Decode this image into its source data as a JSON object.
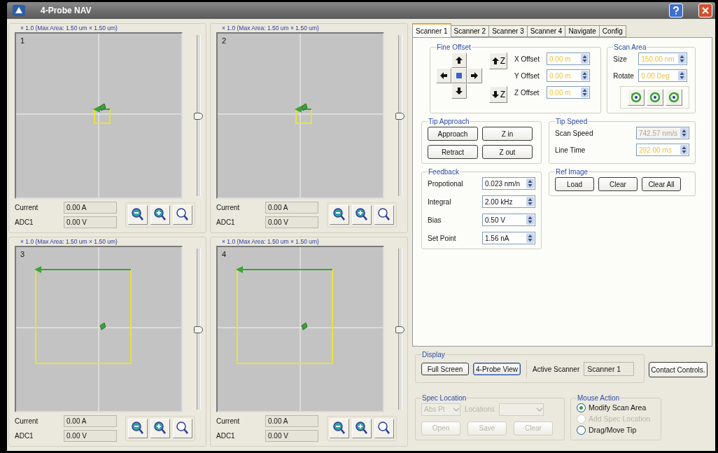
{
  "window": {
    "title": "4-Probe NAV"
  },
  "probes": [
    {
      "header": "× 1.0 (Max Area: 1.50 um × 1.50 um)",
      "number": "1",
      "large_scan": false,
      "slider": {
        "level": 0.5
      },
      "readouts": [
        {
          "label": "Current",
          "value": "0.00 A"
        },
        {
          "label": "ADC1",
          "value": "0.00 V"
        }
      ]
    },
    {
      "header": "× 1.0 (Max Area: 1.50 um × 1.50 um)",
      "number": "2",
      "large_scan": false,
      "slider": {
        "level": 0.5
      },
      "readouts": [
        {
          "label": "Current",
          "value": "0.00 A"
        },
        {
          "label": "ADC1",
          "value": "0.00 V"
        }
      ]
    },
    {
      "header": "× 1.0 (Max Area: 1.50 um × 1.50 um)",
      "number": "3",
      "large_scan": true,
      "slider": {
        "level": 0.5
      },
      "readouts": [
        {
          "label": "Current",
          "value": "0.00 A"
        },
        {
          "label": "ADC1",
          "value": "0.00 V"
        }
      ]
    },
    {
      "header": "× 1.0 (Max Area: 1.50 um × 1.50 um)",
      "number": "4",
      "large_scan": true,
      "slider": {
        "level": 0.5
      },
      "readouts": [
        {
          "label": "Current",
          "value": "0.00 A"
        },
        {
          "label": "ADC1",
          "value": "0.00 V"
        }
      ]
    }
  ],
  "tabs": [
    {
      "label": "Scanner 1",
      "selected": true
    },
    {
      "label": "Scanner 2",
      "selected": false
    },
    {
      "label": "Scanner 3",
      "selected": false
    },
    {
      "label": "Scanner 4",
      "selected": false
    },
    {
      "label": "Navigate",
      "selected": false
    },
    {
      "label": "Config",
      "selected": false
    }
  ],
  "fine_offset": {
    "title": "Fine Offset",
    "z_buttons": [
      "Z",
      "Z"
    ],
    "fields": [
      {
        "label": "X Offset",
        "value": "0.00 m",
        "highlighted": true,
        "disabled": false
      },
      {
        "label": "Y Offset",
        "value": "0.00 m",
        "highlighted": true,
        "disabled": false
      },
      {
        "label": "Z Offset",
        "value": "0.00 m",
        "highlighted": true,
        "disabled": false
      }
    ]
  },
  "scan_area": {
    "title": "Scan Area",
    "fields": [
      {
        "label": "Size",
        "value": "150.00 nm",
        "highlighted": true,
        "disabled": false
      },
      {
        "label": "Rotate",
        "value": "0.00 Deg",
        "highlighted": true,
        "disabled": false
      }
    ]
  },
  "tip_approach": {
    "title": "Tip Approach",
    "buttons": [
      "Approach",
      "Z in",
      "Retract",
      "Z out"
    ]
  },
  "tip_speed": {
    "title": "Tip Speed",
    "fields": [
      {
        "label": "Scan Speed",
        "value": "742.57 nm/s",
        "highlighted": false,
        "disabled": true
      },
      {
        "label": "Line Time",
        "value": "292.00 ms",
        "highlighted": true,
        "disabled": false
      }
    ]
  },
  "feedback": {
    "title": "Feedback",
    "fields": [
      {
        "label": "Propotional",
        "value": "0.023 nm/n",
        "highlighted": false,
        "disabled": false
      },
      {
        "label": "Integral",
        "value": "2.00 kHz",
        "highlighted": false,
        "disabled": false
      },
      {
        "label": "Bias",
        "value": "0.50 V",
        "highlighted": false,
        "disabled": false
      },
      {
        "label": "Set Point",
        "value": "1.56 nA",
        "highlighted": false,
        "disabled": false
      }
    ]
  },
  "ref_image": {
    "title": "Ref Image",
    "buttons": [
      "Load",
      "Clear",
      "Clear All"
    ]
  },
  "display": {
    "title": "Display",
    "buttons": [
      {
        "label": "Full Screen",
        "selected": false
      },
      {
        "label": "4-Probe View",
        "selected": true
      }
    ],
    "active_scanner_label": "Active Scanner",
    "active_scanner": "Scanner 1"
  },
  "contact_button": "Contact Controls.",
  "spec_location": {
    "title": "Spec Location",
    "disabled": true,
    "mode": "Abs Pt",
    "locations_label": "Locations",
    "buttons": [
      "Open",
      "Save",
      "Clear"
    ]
  },
  "mouse_action": {
    "title": "Mouse Action",
    "options": [
      {
        "label": "Modify Scan Area",
        "selected": true,
        "disabled": false
      },
      {
        "label": "Add Spec Location",
        "selected": false,
        "disabled": true
      },
      {
        "label": "Drag/Move Tip",
        "selected": false,
        "disabled": false
      }
    ]
  }
}
